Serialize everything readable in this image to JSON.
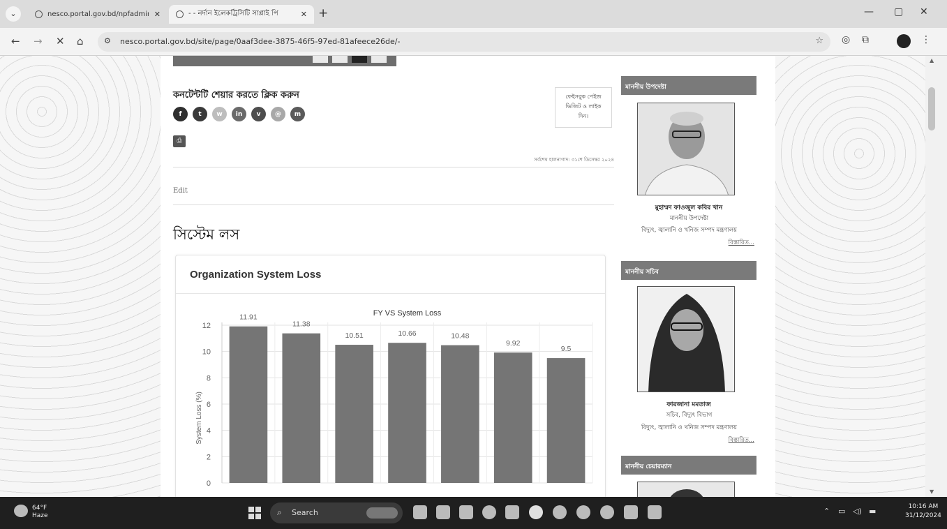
{
  "browser": {
    "tabs": [
      {
        "title": "nesco.portal.gov.bd/npfadmin,"
      },
      {
        "title": "- - নর্দান ইলেকট্রিসিটি সাপ্লাই পি"
      }
    ],
    "url": "nesco.portal.gov.bd/site/page/0aaf3dee-3875-46f5-97ed-81afeece26de/-"
  },
  "page": {
    "share_title": "কনটেন্টটি শেয়ার করতে ক্লিক করুন",
    "share_buttons": [
      {
        "label": "f",
        "icon": "facebook-icon",
        "color": "#2f2f2f"
      },
      {
        "label": "t",
        "icon": "twitter-icon",
        "color": "#3a3a3a"
      },
      {
        "label": "w",
        "icon": "whatsapp-icon",
        "color": "#bdbdbd"
      },
      {
        "label": "in",
        "icon": "linkedin-icon",
        "color": "#6a6a6a"
      },
      {
        "label": "v",
        "icon": "viber-icon",
        "color": "#4d4d4d"
      },
      {
        "label": "@",
        "icon": "link-icon",
        "color": "#a8a8a8"
      },
      {
        "label": "m",
        "icon": "messenger-icon",
        "color": "#5a5a5a"
      }
    ],
    "facebook_box": [
      "ফেইসবুক পেইজ",
      "ভিজিট ও লাইক",
      "দিন।"
    ],
    "last_updated": "সর্বশেষ হালনাগাদ: ৩১শে ডিসেম্বর ২০২৪",
    "edit_label": "Edit",
    "page_title": "সিস্টেম লস",
    "card_title": "Organization System Loss"
  },
  "chart_data": {
    "type": "bar",
    "title": "FY VS System Loss",
    "ylabel": "System Loss (%)",
    "xlabel": "",
    "categories": [
      "",
      "",
      "",
      "",
      "",
      "",
      ""
    ],
    "values": [
      11.91,
      11.38,
      10.51,
      10.66,
      10.48,
      9.92,
      9.5
    ],
    "value_labels": [
      "11.91",
      "11.38",
      "10.51",
      "10.66",
      "10.48",
      "9.92",
      "9.5"
    ],
    "yticks": [
      0,
      2,
      4,
      6,
      8,
      10,
      12
    ],
    "ylim": [
      0,
      12
    ],
    "grid": true,
    "bar_color": "#757575"
  },
  "sidebar": [
    {
      "header": "মাননীয় উপদেষ্টা",
      "name": "মুহাম্মদ ফাওজুল কবির খান",
      "role": "মাননীয় উপদেষ্টা",
      "ministry": "বিদ্যুৎ, জ্বালানি ও খনিজ সম্পদ মন্ত্রণালয়",
      "more": "বিস্তারিত..."
    },
    {
      "header": "মাননীয় সচিব",
      "name": "ফারজানা মমতাজ",
      "role": "সচিব, বিদ্যুৎ বিভাগ",
      "ministry": "বিদ্যুৎ, জ্বালানি ও খনিজ সম্পদ মন্ত্রণালয়",
      "more": "বিস্তারিত..."
    },
    {
      "header": "মাননীয় চেয়ারম্যান"
    }
  ],
  "taskbar": {
    "weather_temp": "64°F",
    "weather_desc": "Haze",
    "search_label": "Search",
    "time": "10:16 AM",
    "date": "31/12/2024"
  }
}
